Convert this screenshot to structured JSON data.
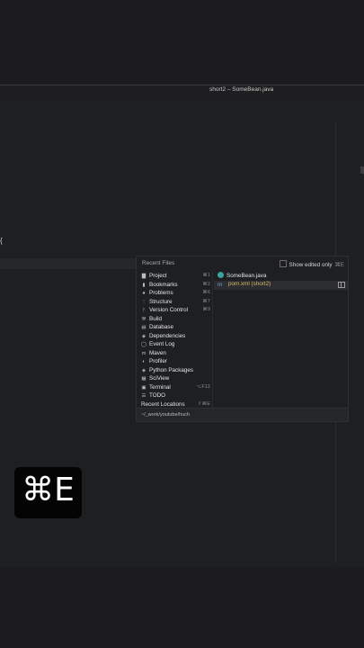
{
  "window": {
    "title": "short2 – SomeBean.java"
  },
  "editor": {
    "brace_text": "{"
  },
  "popup": {
    "title": "Recent Files",
    "show_edited_label": "Show edited only",
    "show_edited_shortcut": "⌘E",
    "nav_items": [
      {
        "icon": "folder-icon",
        "glyph": "▇",
        "label": "Project",
        "shortcut": "⌘1"
      },
      {
        "icon": "bookmark-icon",
        "glyph": "▮",
        "label": "Bookmarks",
        "shortcut": "⌘2"
      },
      {
        "icon": "problems-icon",
        "glyph": "●",
        "label": "Problems",
        "shortcut": "⌘6"
      },
      {
        "icon": "structure-icon",
        "glyph": "⋮",
        "label": "Structure",
        "shortcut": "⌘7"
      },
      {
        "icon": "version-control-icon",
        "glyph": "ᚹ",
        "label": "Version Control",
        "shortcut": "⌘9"
      },
      {
        "icon": "hammer-icon",
        "glyph": "⚒",
        "label": "Build",
        "shortcut": ""
      },
      {
        "icon": "database-icon",
        "glyph": "▤",
        "label": "Database",
        "shortcut": ""
      },
      {
        "icon": "dependencies-icon",
        "glyph": "◈",
        "label": "Dependencies",
        "shortcut": ""
      },
      {
        "icon": "event-log-icon",
        "glyph": "◯",
        "label": "Event Log",
        "shortcut": ""
      },
      {
        "icon": "maven-icon",
        "glyph": "m",
        "label": "Maven",
        "shortcut": ""
      },
      {
        "icon": "profiler-icon",
        "glyph": "◐",
        "label": "Profiler",
        "shortcut": ""
      },
      {
        "icon": "python-packages-icon",
        "glyph": "◈",
        "label": "Python Packages",
        "shortcut": ""
      },
      {
        "icon": "sciview-icon",
        "glyph": "▦",
        "label": "SciView",
        "shortcut": ""
      },
      {
        "icon": "terminal-icon",
        "glyph": "▣",
        "label": "Terminal",
        "shortcut": "⌥F12"
      },
      {
        "icon": "todo-icon",
        "glyph": "☰",
        "label": "TODO",
        "shortcut": ""
      }
    ],
    "recent_locations": {
      "label": "Recent Locations",
      "shortcut": "⇧⌘E"
    },
    "files": [
      {
        "icon": "java-class-icon",
        "label": "SomeBean.java",
        "selected": false
      },
      {
        "icon": "maven-file-icon",
        "label": "pom.xml (short2)",
        "selected": true
      }
    ],
    "footer_path": "~/_work/youtube/huch"
  },
  "overlay": {
    "keystroke": "⌘E"
  }
}
